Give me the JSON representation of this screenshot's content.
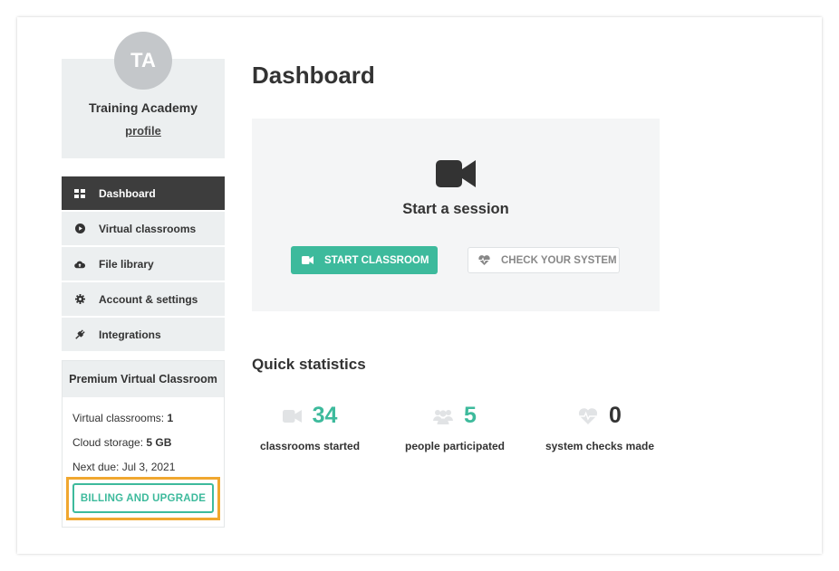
{
  "profile": {
    "initials": "TA",
    "name": "Training Academy",
    "link": "profile"
  },
  "nav": [
    {
      "label": "Dashboard",
      "icon": "dashboard-grid-icon",
      "active": true
    },
    {
      "label": "Virtual classrooms",
      "icon": "play-circle-icon"
    },
    {
      "label": "File library",
      "icon": "cloud-upload-icon"
    },
    {
      "label": "Account & settings",
      "icon": "gear-icon"
    },
    {
      "label": "Integrations",
      "icon": "plug-icon"
    }
  ],
  "plan": {
    "title": "Premium Virtual Classroom",
    "classrooms_label": "Virtual classrooms:",
    "classrooms_value": "1",
    "storage_label": "Cloud storage:",
    "storage_value": "5 GB",
    "next_due": "Next due: Jul 3, 2021",
    "billing_button": "BILLING AND UPGRADE"
  },
  "main": {
    "title": "Dashboard",
    "session_title": "Start a session",
    "start_button": "START CLASSROOM",
    "check_button": "CHECK YOUR SYSTEM",
    "stats_title": "Quick statistics",
    "stats": [
      {
        "value": "34",
        "label": "classrooms started",
        "icon": "video-camera-icon"
      },
      {
        "value": "5",
        "label": "people participated",
        "icon": "people-icon"
      },
      {
        "value": "0",
        "label": "system checks made",
        "icon": "heart-pulse-icon"
      }
    ]
  },
  "colors": {
    "accent": "#3dba9c",
    "highlight": "#f0a72f",
    "nav_active": "#3d3d3d",
    "panel": "#eceff0"
  }
}
